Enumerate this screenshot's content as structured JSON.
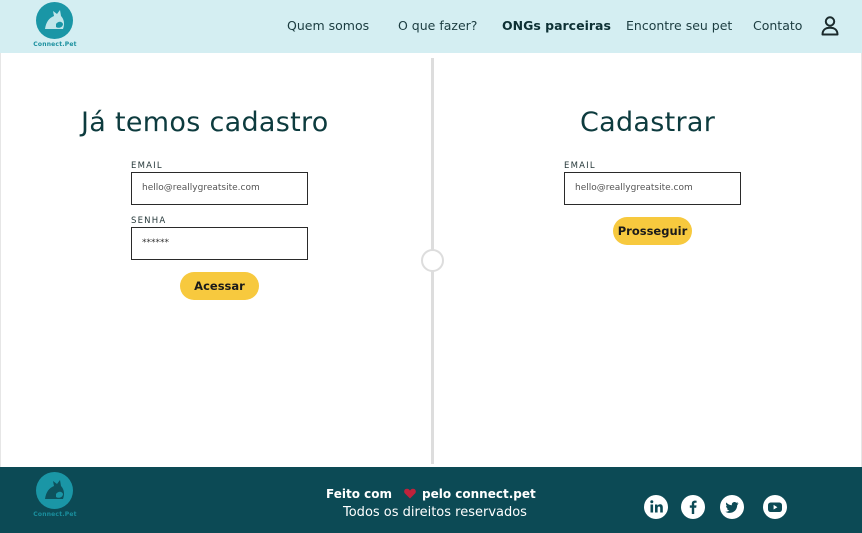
{
  "header": {
    "logo_text": "Connect.Pet",
    "nav": [
      {
        "label": "Quem somos"
      },
      {
        "label": "O que fazer?"
      },
      {
        "label": "ONGs parceiras"
      },
      {
        "label": "Encontre seu pet"
      },
      {
        "label": "Contato"
      }
    ],
    "active_nav": "ONGs parceiras",
    "user_icon": "user-icon"
  },
  "login": {
    "title": "Já temos cadastro",
    "email_label": "EMAIL",
    "email_value": "hello@reallygreatsite.com",
    "password_label": "SENHA",
    "password_value": "******",
    "submit_label": "Acessar"
  },
  "register": {
    "title": "Cadastrar",
    "email_label": "EMAIL",
    "email_value": "hello@reallygreatsite.com",
    "submit_label": "Prosseguir"
  },
  "footer": {
    "logo_text": "Connect.Pet",
    "made_with_prefix": "Feito com",
    "made_with_suffix": "pelo connect.pet",
    "rights": "Todos os direitos reservados",
    "social": [
      "linkedin-icon",
      "facebook-icon",
      "twitter-icon",
      "youtube-icon"
    ]
  },
  "colors": {
    "header_bg": "#d4eef2",
    "footer_bg": "#0c4a55",
    "accent_button": "#f7c93e",
    "logo_teal": "#1a96a6",
    "heart": "#c0223b"
  }
}
